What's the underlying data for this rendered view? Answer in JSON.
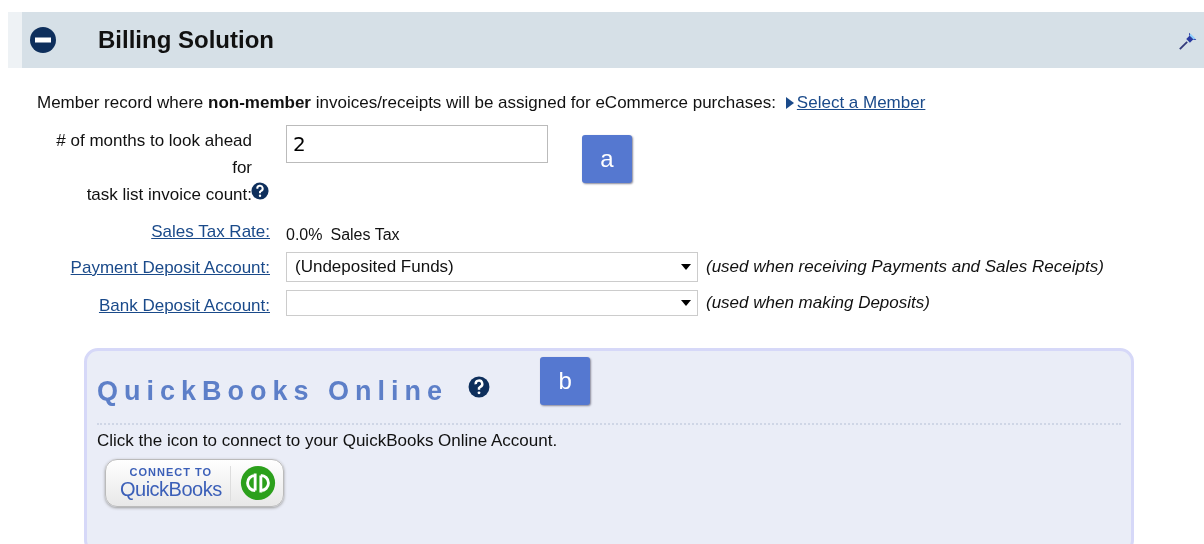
{
  "panel": {
    "title": "Billing Solution",
    "expanded": true
  },
  "member_line": {
    "text": "Member record where **non-member** invoices/receipts will be assigned for eCommerce purchases:",
    "link": "Select a Member"
  },
  "months_field": {
    "label_lines": [
      "# of months to look ahead",
      "for",
      "task list invoice count:"
    ],
    "value": "2"
  },
  "sales_tax": {
    "label": "Sales Tax Rate:",
    "rate": "0.0%",
    "suffix": "Sales Tax"
  },
  "accounts": [
    {
      "label": "Payment Deposit Account:",
      "value": "(Undeposited Funds)",
      "note": "(used when receiving Payments and Sales Receipts)"
    },
    {
      "label": "Bank Deposit Account:",
      "note": "(used when making Deposits)"
    }
  ],
  "callouts": [
    "a",
    "b"
  ],
  "quickbooks": {
    "title": "QuickBooks Online",
    "text": "Click the icon to connect to your QuickBooks Online Account.",
    "button_top": "CONNECT TO",
    "button_main": "QuickBooks"
  }
}
